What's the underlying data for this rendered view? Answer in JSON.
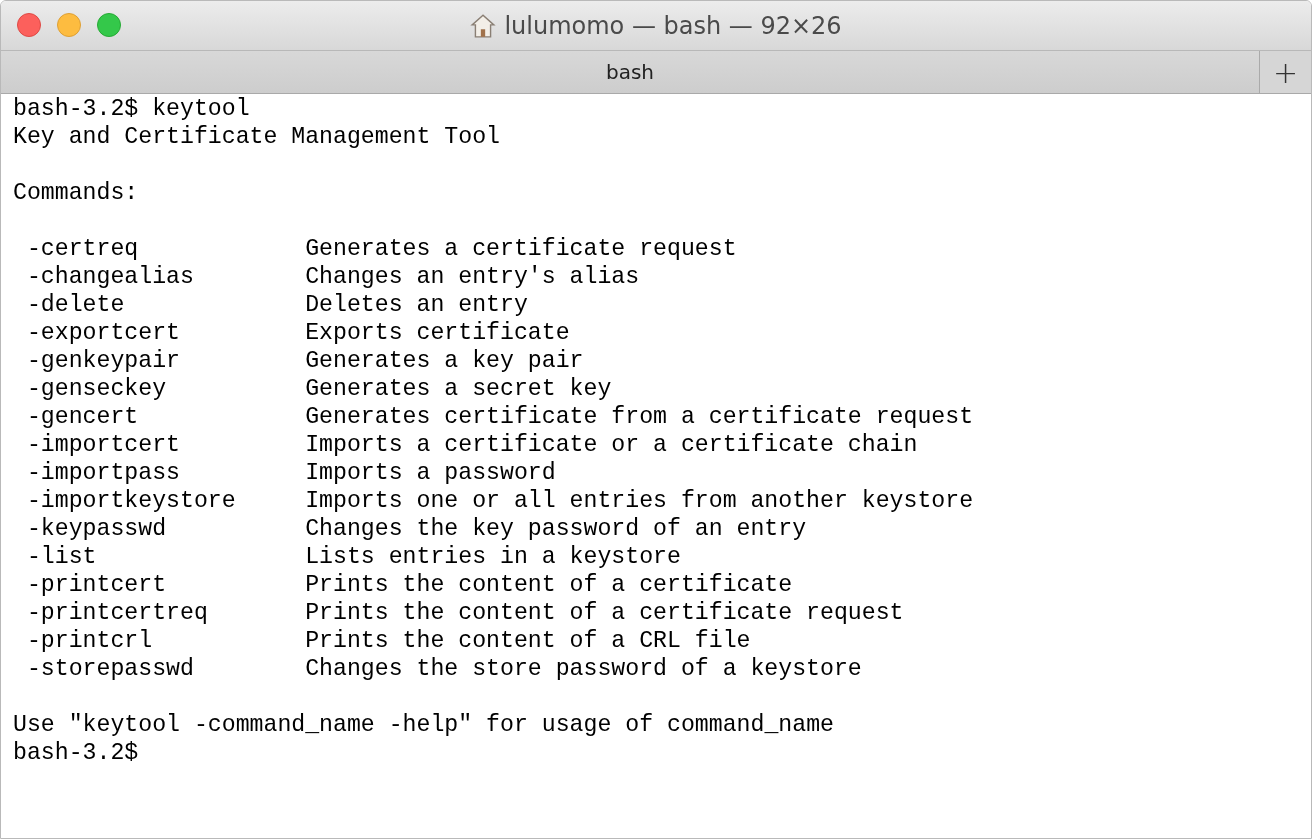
{
  "window": {
    "title": "lulumomo — bash — 92×26"
  },
  "tabs": [
    {
      "label": "bash",
      "selected": true
    }
  ],
  "new_tab_button": "+",
  "terminal": {
    "prompt_line": "bash-3.2$ keytool",
    "heading": "Key and Certificate Management Tool",
    "commands_label": "Commands:",
    "commands": [
      {
        "name": "-certreq",
        "description": "Generates a certificate request"
      },
      {
        "name": "-changealias",
        "description": "Changes an entry's alias"
      },
      {
        "name": "-delete",
        "description": "Deletes an entry"
      },
      {
        "name": "-exportcert",
        "description": "Exports certificate"
      },
      {
        "name": "-genkeypair",
        "description": "Generates a key pair"
      },
      {
        "name": "-genseckey",
        "description": "Generates a secret key"
      },
      {
        "name": "-gencert",
        "description": "Generates certificate from a certificate request"
      },
      {
        "name": "-importcert",
        "description": "Imports a certificate or a certificate chain"
      },
      {
        "name": "-importpass",
        "description": "Imports a password"
      },
      {
        "name": "-importkeystore",
        "description": "Imports one or all entries from another keystore"
      },
      {
        "name": "-keypasswd",
        "description": "Changes the key password of an entry"
      },
      {
        "name": "-list",
        "description": "Lists entries in a keystore"
      },
      {
        "name": "-printcert",
        "description": "Prints the content of a certificate"
      },
      {
        "name": "-printcertreq",
        "description": "Prints the content of a certificate request"
      },
      {
        "name": "-printcrl",
        "description": "Prints the content of a CRL file"
      },
      {
        "name": "-storepasswd",
        "description": "Changes the store password of a keystore"
      }
    ],
    "usage": "Use \"keytool -command_name -help\" for usage of command_name",
    "final_prompt": "bash-3.2$"
  }
}
